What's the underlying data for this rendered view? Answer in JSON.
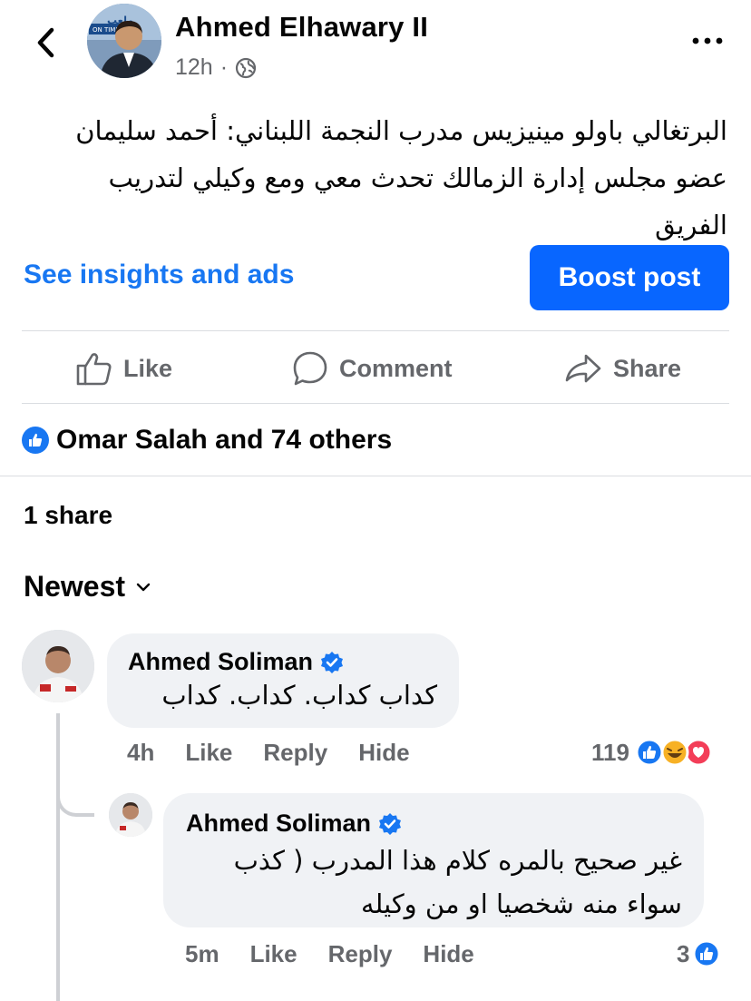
{
  "header": {
    "back_icon": "chevron-left-icon",
    "author": "Ahmed Elhawary II",
    "time": "12h",
    "separator": "·",
    "audience_icon": "globe-icon",
    "more_icon": "more-horizontal-icon",
    "avatar_badge": "ملعب",
    "avatar_badge_sub": "ON TIME"
  },
  "post": {
    "text": "البرتغالي باولو مينيزيس مدرب النجمة اللبناني: أحمد سليمان عضو مجلس إدارة الزمالك تحدث معي ومع وكيلي لتدريب الفريق"
  },
  "promo": {
    "insights_label": "See insights and ads",
    "boost_label": "Boost post"
  },
  "actions": {
    "like": "Like",
    "comment": "Comment",
    "share": "Share"
  },
  "reactions": {
    "summary": "Omar Salah and 74 others"
  },
  "shares": {
    "label": "1 share"
  },
  "sort": {
    "label": "Newest"
  },
  "comments": [
    {
      "name": "Ahmed Soliman",
      "verified": true,
      "text": "كداب كداب. كداب. كداب",
      "time": "4h",
      "like": "Like",
      "reply": "Reply",
      "hide": "Hide",
      "reaction_count": "119"
    },
    {
      "name": "Ahmed Soliman",
      "verified": true,
      "text": "غير صحيح بالمره كلام هذا المدرب ( كذب سواء منه شخصيا او من وكيله",
      "time": "5m",
      "like": "Like",
      "reply": "Reply",
      "hide": "Hide",
      "reaction_count": "3"
    }
  ],
  "colors": {
    "accent": "#1877f2",
    "boost_bg": "#0866ff",
    "muted": "#65676b",
    "bubble": "#f0f2f5",
    "divider": "#dadde1"
  }
}
